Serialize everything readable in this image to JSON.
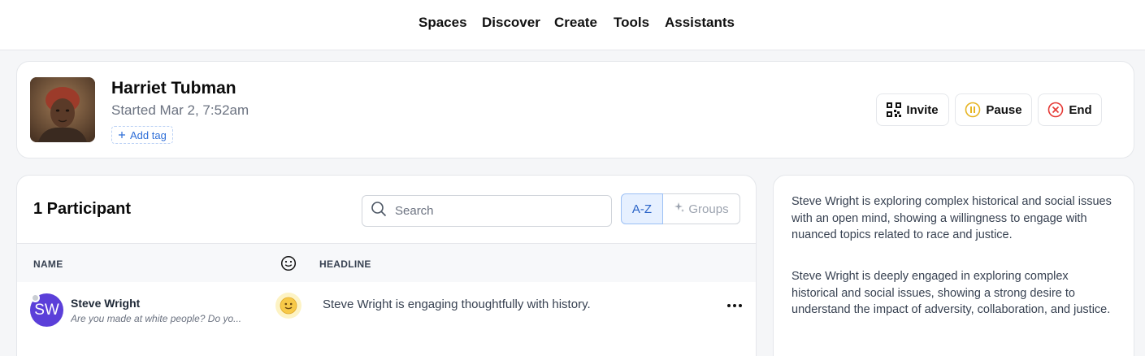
{
  "nav": {
    "items": [
      {
        "label": "Spaces"
      },
      {
        "label": "Discover"
      },
      {
        "label": "Create"
      },
      {
        "label": "Tools"
      },
      {
        "label": "Assistants"
      }
    ]
  },
  "session": {
    "title": "Harriet Tubman",
    "started": "Started Mar 2, 7:52am",
    "add_tag_label": "Add tag",
    "actions": {
      "invite": "Invite",
      "pause": "Pause",
      "end": "End"
    },
    "colors": {
      "pause": "#e6b422",
      "end": "#e53935"
    }
  },
  "participants": {
    "title": "1 Participant",
    "search_placeholder": "Search",
    "sort_az": "A-Z",
    "groups": "Groups",
    "columns": {
      "name": "NAME",
      "headline": "HEADLINE"
    },
    "rows": [
      {
        "initials": "SW",
        "name": "Steve Wright",
        "subtitle": "Are you made at white people? Do yo...",
        "mood_icon": "slightly-smiling-face-icon",
        "headline": "Steve Wright is engaging thoughtfully with history."
      }
    ]
  },
  "summary": {
    "paragraphs": [
      "Steve Wright is exploring complex historical and social issues with an open mind, showing a willingness to engage with nuanced topics related to race and justice.",
      "Steve Wright is deeply engaged in exploring complex historical and social issues, showing a strong desire to understand the impact of adversity, collaboration, and justice."
    ]
  }
}
